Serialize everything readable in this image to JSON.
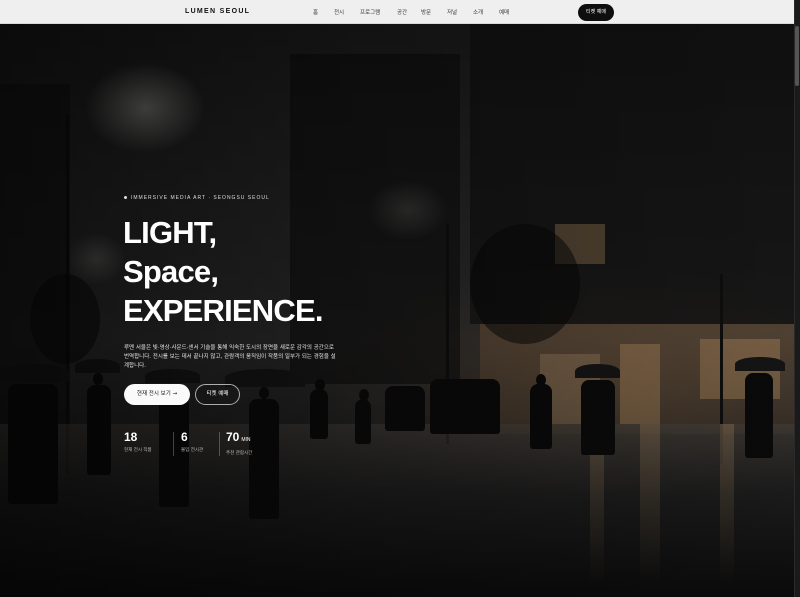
{
  "nav": {
    "logo": "LUMEN SEOUL",
    "items": [
      {
        "label": "홈"
      },
      {
        "label": "전시"
      },
      {
        "label": "프로그램"
      },
      {
        "label": "공간"
      },
      {
        "label": "방문"
      },
      {
        "label": "저널"
      },
      {
        "label": "소개"
      },
      {
        "label": "예매"
      }
    ],
    "cta_label": "티켓 예매"
  },
  "hero": {
    "eyebrow": "IMMERSIVE MEDIA ART · SEONGSU SEOUL",
    "headline": [
      "LIGHT,",
      "Space,",
      "EXPERIENCE."
    ],
    "description": "루멘 서울은 빛·영상·사운드·센서 기술을 통해 익숙한 도시의 장면을 새로운 감각의 공간으로 번역합니다. 전시를 보는 데서 끝나지 않고, 관람객의 움직임이 작품의 일부가 되는 경험을 설계합니다.",
    "primary_button": "현재 전시 보기 →",
    "secondary_button": "티켓 예매",
    "stats": [
      {
        "value": "18",
        "unit": "",
        "label": "현재 전시 작품"
      },
      {
        "value": "6",
        "unit": "",
        "label": "몰입 전시관"
      },
      {
        "value": "70",
        "unit": "MIN",
        "label": "추천 관람시간"
      }
    ]
  },
  "colors": {
    "nav_bg": "#efefef",
    "cta_bg": "#0e0e0e",
    "text_light": "#ffffff"
  }
}
